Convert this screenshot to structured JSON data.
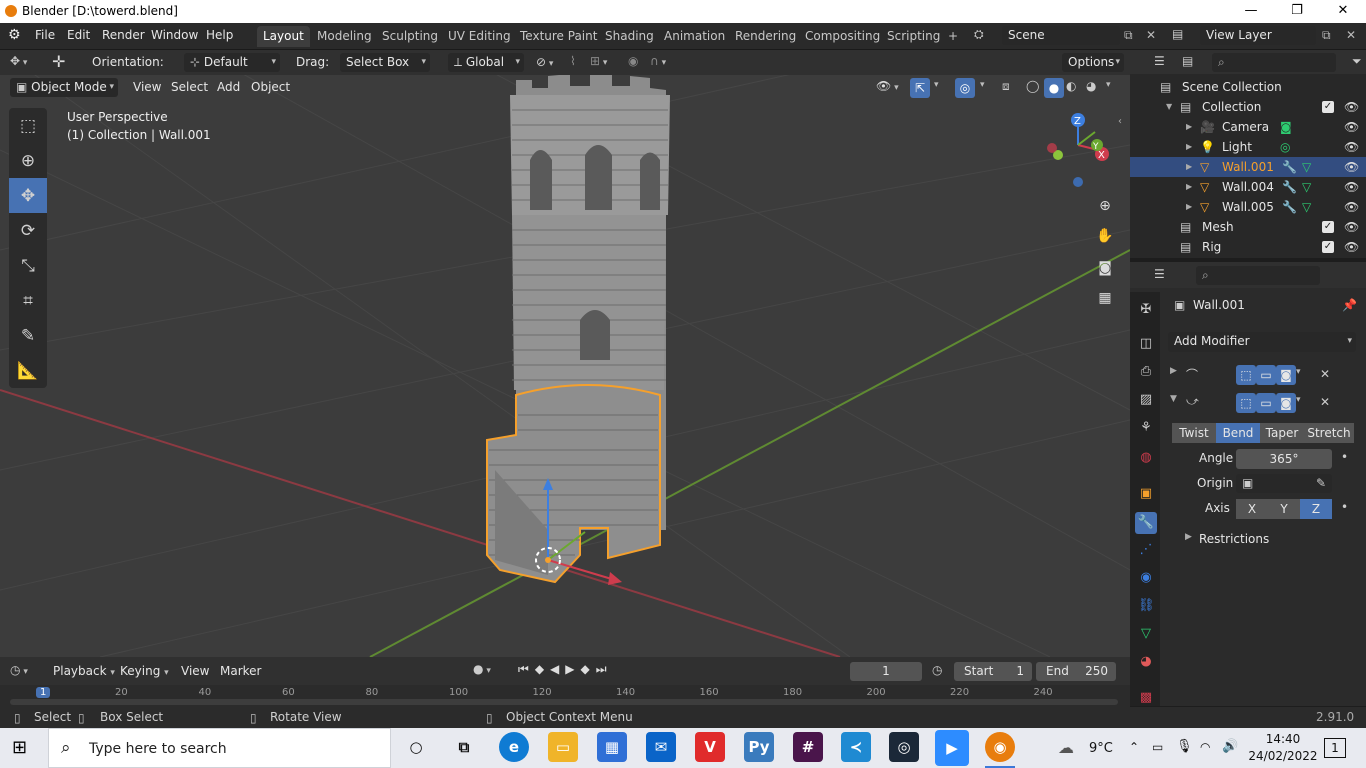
{
  "window": {
    "title": "Blender [D:\\towerd.blend]",
    "minimize": "—",
    "maximize": "❐",
    "close": "✕"
  },
  "menu": [
    "File",
    "Edit",
    "Render",
    "Window",
    "Help"
  ],
  "workspaces": [
    "Layout",
    "Modeling",
    "Sculpting",
    "UV Editing",
    "Texture Paint",
    "Shading",
    "Animation",
    "Rendering",
    "Compositing",
    "Scripting"
  ],
  "workspace_add": "+",
  "scene": {
    "name": "Scene",
    "view_layer": "View Layer"
  },
  "tool_header": {
    "orientation_label": "Orientation:",
    "orientation_value": "Default",
    "drag_label": "Drag:",
    "drag_value": "Select Box",
    "transform_orientation": "Global",
    "options": "Options"
  },
  "viewport_header": {
    "mode": "Object Mode",
    "menus": [
      "View",
      "Select",
      "Add",
      "Object"
    ]
  },
  "viewport": {
    "perspective": "User Perspective",
    "collection_info": "(1) Collection | Wall.001"
  },
  "gizmo": {
    "x": "X",
    "y": "Y",
    "z": "Z"
  },
  "outliner": {
    "rows": [
      {
        "label": "Scene Collection",
        "kind": "scene-collection",
        "depth": 0
      },
      {
        "label": "Collection",
        "kind": "collection",
        "depth": 1
      },
      {
        "label": "Camera",
        "kind": "camera",
        "depth": 2
      },
      {
        "label": "Light",
        "kind": "light",
        "depth": 2
      },
      {
        "label": "Wall.001",
        "kind": "mesh",
        "depth": 2,
        "selected": true
      },
      {
        "label": "Wall.004",
        "kind": "mesh",
        "depth": 2
      },
      {
        "label": "Wall.005",
        "kind": "mesh",
        "depth": 2
      },
      {
        "label": "Mesh",
        "kind": "collection",
        "depth": 1
      },
      {
        "label": "Rig",
        "kind": "collection",
        "depth": 1
      }
    ]
  },
  "properties": {
    "object_name": "Wall.001",
    "add_modifier": "Add Modifier",
    "deform_modes": [
      "Twist",
      "Bend",
      "Taper",
      "Stretch"
    ],
    "deform_active": "Bend",
    "angle_label": "Angle",
    "angle_value": "365°",
    "origin_label": "Origin",
    "axis_label": "Axis",
    "axes": [
      "X",
      "Y",
      "Z"
    ],
    "axis_active": "Z",
    "restrictions": "Restrictions"
  },
  "timeline": {
    "menus": [
      "Playback",
      "Keying",
      "View",
      "Marker"
    ],
    "current_frame": "1",
    "start_label": "Start",
    "start_value": "1",
    "end_label": "End",
    "end_value": "250",
    "ruler": [
      "1",
      "20",
      "40",
      "60",
      "80",
      "100",
      "120",
      "140",
      "160",
      "180",
      "200",
      "220",
      "240"
    ]
  },
  "statusbar": {
    "select": "Select",
    "box_select": "Box Select",
    "rotate_view": "Rotate View",
    "context_menu": "Object Context Menu",
    "version": "2.91.0"
  },
  "taskbar": {
    "search_placeholder": "Type here to search",
    "weather": "9°C",
    "time": "14:40",
    "date": "24/02/2022",
    "notifications": "1"
  },
  "colors": {
    "accent": "#4772b3",
    "selection_orange": "#f5a02c",
    "x_axis": "#cf3c4d",
    "y_axis": "#6ba82f",
    "z_axis": "#3d7fe0"
  }
}
